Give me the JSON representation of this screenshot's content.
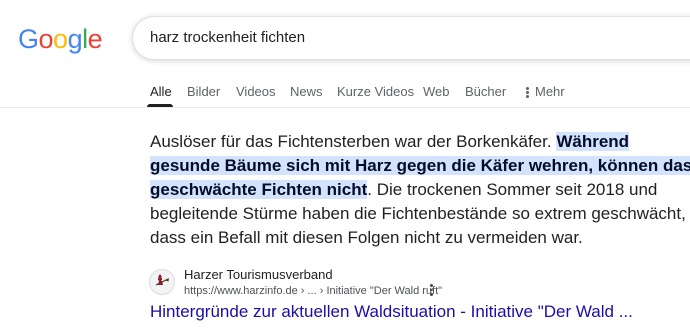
{
  "logo": {
    "letters": [
      "G",
      "o",
      "o",
      "g",
      "l",
      "e"
    ],
    "colors": [
      "#4285F4",
      "#EA4335",
      "#FBBC05",
      "#4285F4",
      "#34A853",
      "#EA4335"
    ]
  },
  "search": {
    "query": "harz trockenheit fichten"
  },
  "tabs": [
    {
      "label": "Alle",
      "active": true
    },
    {
      "label": "Bilder"
    },
    {
      "label": "Videos"
    },
    {
      "label": "News"
    },
    {
      "label": "Kurze Videos"
    },
    {
      "label": "Web"
    },
    {
      "label": "Bücher"
    },
    {
      "label": "Mehr"
    }
  ],
  "snippet": {
    "part1": "Auslöser für das Fichtensterben war der Borkenkäfer. ",
    "highlight": "Während gesunde Bäume sich mit Harz gegen die Käfer wehren, können das geschwächte Fichten nicht",
    "part2": ". Die trockenen Sommer seit 2018 und begleitende Stürme haben die Fichtenbestände so extrem geschwächt, dass ein Befall mit diesen Folgen nicht zu vermeiden war."
  },
  "result": {
    "site_name": "Harzer Tourismusverband",
    "url": "https://www.harzinfo.de › ... › Initiative \"Der Wald ruft\"",
    "title": "Hintergründe zur aktuellen Waldsituation - Initiative \"Der Wald ...",
    "favicon_icon": "witch-icon",
    "favicon_color": "#8b1a2b"
  },
  "colors": {
    "link": "#1a0dab",
    "highlight_bg": "#d3e3fd"
  }
}
